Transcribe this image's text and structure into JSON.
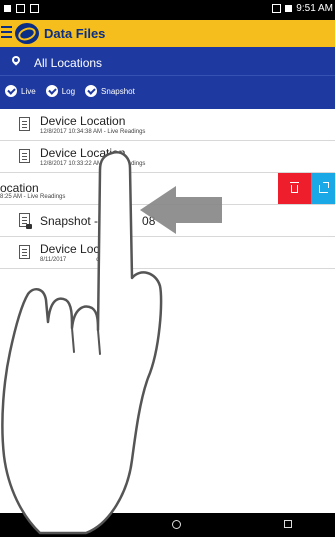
{
  "status_bar": {
    "time": "9:51 AM"
  },
  "app_bar": {
    "title": "Data Files",
    "menu_icon": "hamburger-menu-icon",
    "logo_icon": "app-logo-icon"
  },
  "location": {
    "label": "All Locations",
    "icon": "location-pin-icon"
  },
  "filters": [
    {
      "label": "Live",
      "checked": true
    },
    {
      "label": "Log",
      "checked": true
    },
    {
      "label": "Snapshot",
      "checked": true
    }
  ],
  "rows": [
    {
      "title": "Device Location",
      "subtitle": "12/8/2017 10:34:38 AM - Live Readings",
      "icon": "document-icon"
    },
    {
      "title": "Device Location",
      "subtitle": "12/8/2017 10:33:22 AM - Live Readings",
      "icon": "document-icon"
    },
    {
      "title": "ocation",
      "subtitle": "8:25 AM - Live Readings",
      "icon": "document-icon",
      "swiped": true
    },
    {
      "title": "Snapshot - 2",
      "title_tail": "08",
      "subtitle": "",
      "icon": "snapshot-document-icon"
    },
    {
      "title": "Device Locat",
      "subtitle": "8/11/2017",
      "subtitle_tail": "dings",
      "icon": "document-icon"
    }
  ],
  "swipe_actions": {
    "delete_icon": "trash-icon",
    "share_icon": "share-icon"
  },
  "colors": {
    "app_bar": "#f6be1c",
    "filter_bar": "#1e3aa0",
    "delete": "#ee1e2d",
    "share": "#1aa8e6"
  }
}
